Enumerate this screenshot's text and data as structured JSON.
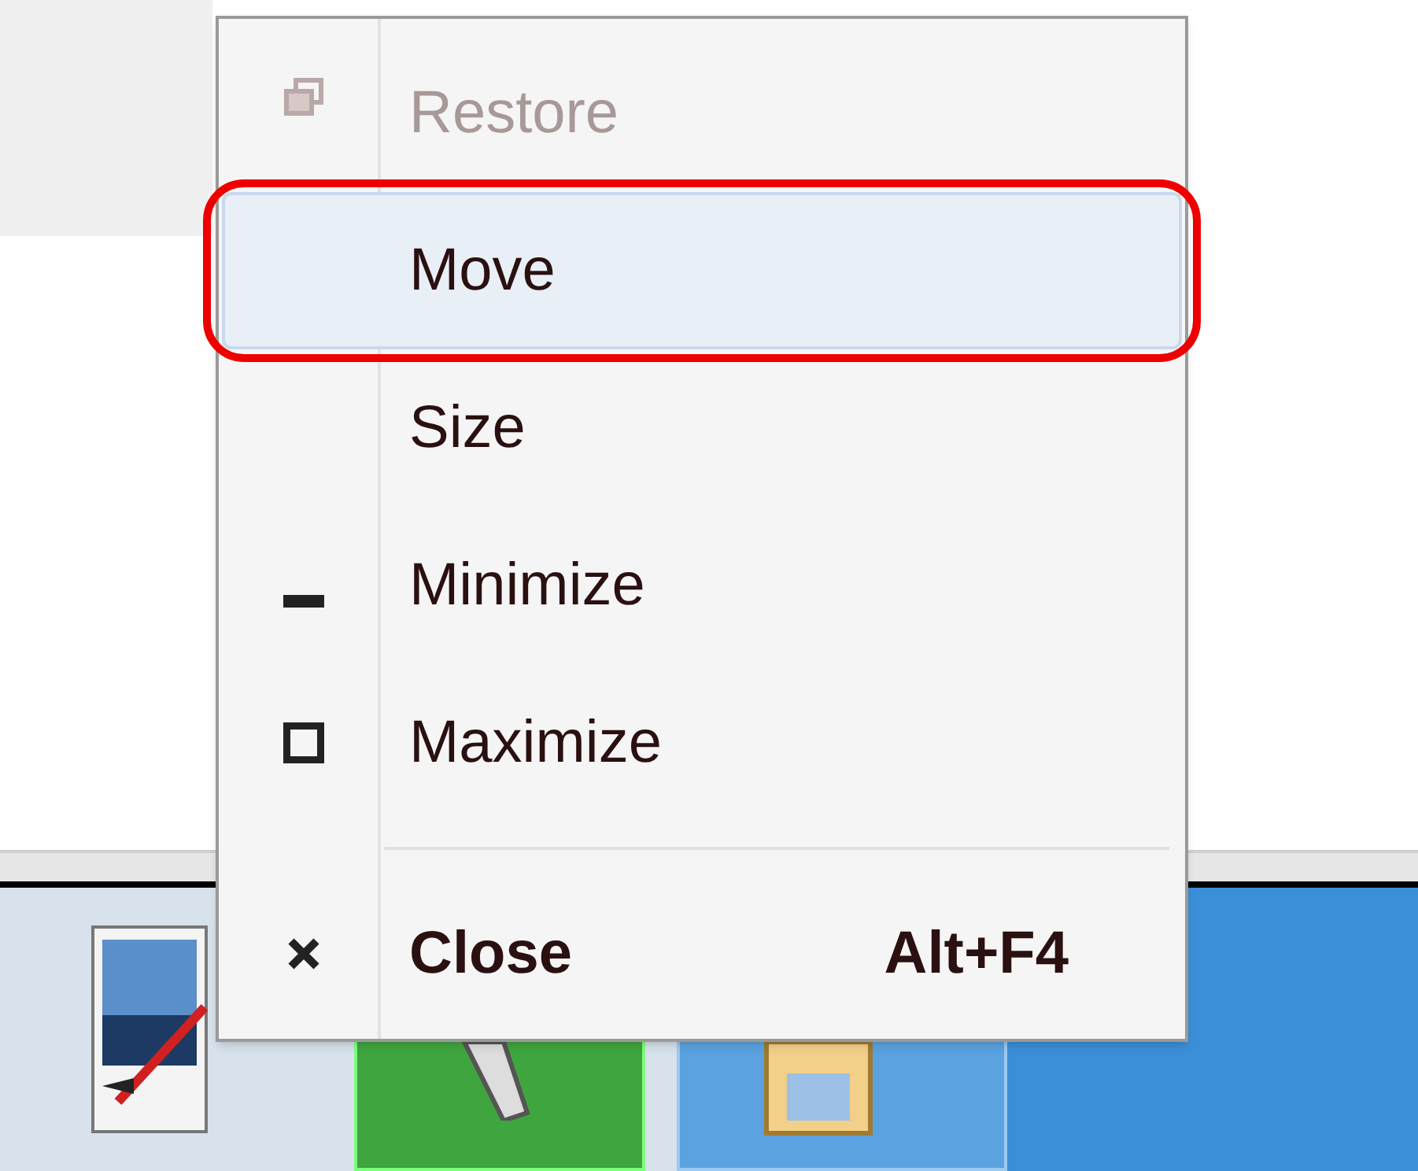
{
  "menu": {
    "items": [
      {
        "kind": "restore",
        "label": "Restore",
        "disabled": true,
        "selected": false,
        "annotated": false
      },
      {
        "kind": "move",
        "label": "Move",
        "disabled": false,
        "selected": true,
        "annotated": true
      },
      {
        "kind": "size",
        "label": "Size",
        "disabled": false,
        "selected": false,
        "annotated": false
      },
      {
        "kind": "minimize",
        "label": "Minimize",
        "disabled": false,
        "selected": false,
        "annotated": false
      },
      {
        "kind": "maximize",
        "label": "Maximize",
        "disabled": false,
        "selected": false,
        "annotated": false
      },
      {
        "kind": "separator"
      },
      {
        "kind": "close",
        "label": "Close",
        "shortcut": "Alt+F4",
        "disabled": false,
        "selected": false,
        "annotated": false
      }
    ]
  }
}
